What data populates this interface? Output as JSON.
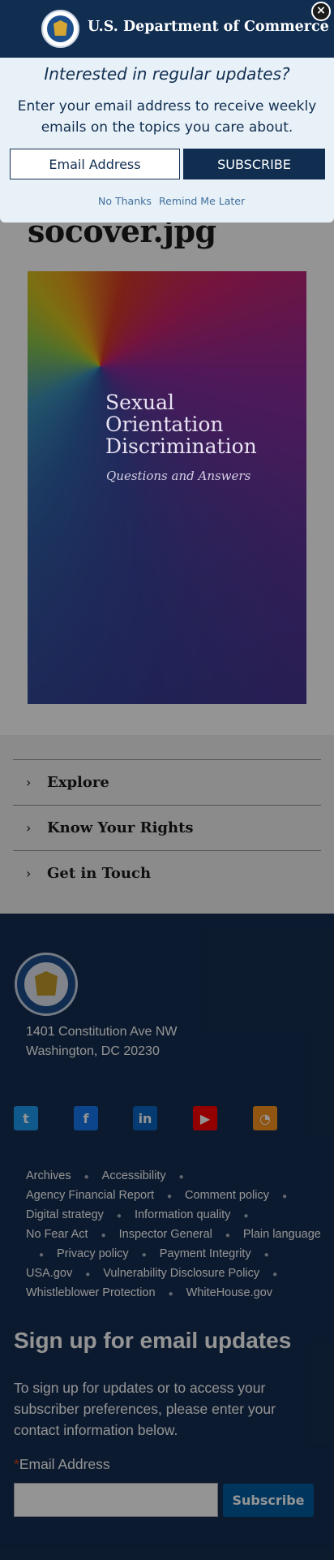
{
  "page": {
    "title": "socover.jpg",
    "cover": {
      "title_lines": [
        "Sexual",
        "Orientation",
        "Discrimination"
      ],
      "subtitle": "Questions and Answers"
    }
  },
  "accordion": {
    "items": [
      {
        "label": "Explore"
      },
      {
        "label": "Know Your Rights"
      },
      {
        "label": "Get in Touch"
      }
    ]
  },
  "footer": {
    "address_line1": "1401 Constitution Ave NW",
    "address_line2": "Washington, DC 20230",
    "social": [
      {
        "icon": "twitter-icon",
        "color": "#1d9bf0"
      },
      {
        "icon": "facebook-icon",
        "color": "#1877f2"
      },
      {
        "icon": "linkedin-icon",
        "color": "#0a66c2"
      },
      {
        "icon": "youtube-icon",
        "color": "#ff0000"
      },
      {
        "icon": "rss-icon",
        "color": "#f7931e"
      }
    ],
    "links": [
      "Archives",
      "Accessibility",
      "Agency Financial Report",
      "Comment policy",
      "Digital strategy",
      "Information quality",
      "No Fear Act",
      "Inspector General",
      "Plain language",
      "Privacy policy",
      "Payment Integrity",
      "USA.gov",
      "Vulnerability Disclosure Policy",
      "Whistleblower Protection",
      "WhiteHouse.gov"
    ],
    "signup_heading": "Sign up for email updates",
    "signup_text": "To sign up for updates or to access your subscriber preferences, please enter your contact information below.",
    "required_star": "*",
    "email_label": "Email Address",
    "subscribe_label": "Subscribe"
  },
  "modal": {
    "agency": "U.S. Department of Commerce",
    "close_glyph": "×",
    "heading": "Interested in regular updates?",
    "text": "Enter your email address to receive weekly emails on the topics you care about.",
    "email_placeholder": "Email Address",
    "subscribe_label": "SUBSCRIBE",
    "no_thanks": "No Thanks",
    "remind_later": "Remind Me Later"
  }
}
